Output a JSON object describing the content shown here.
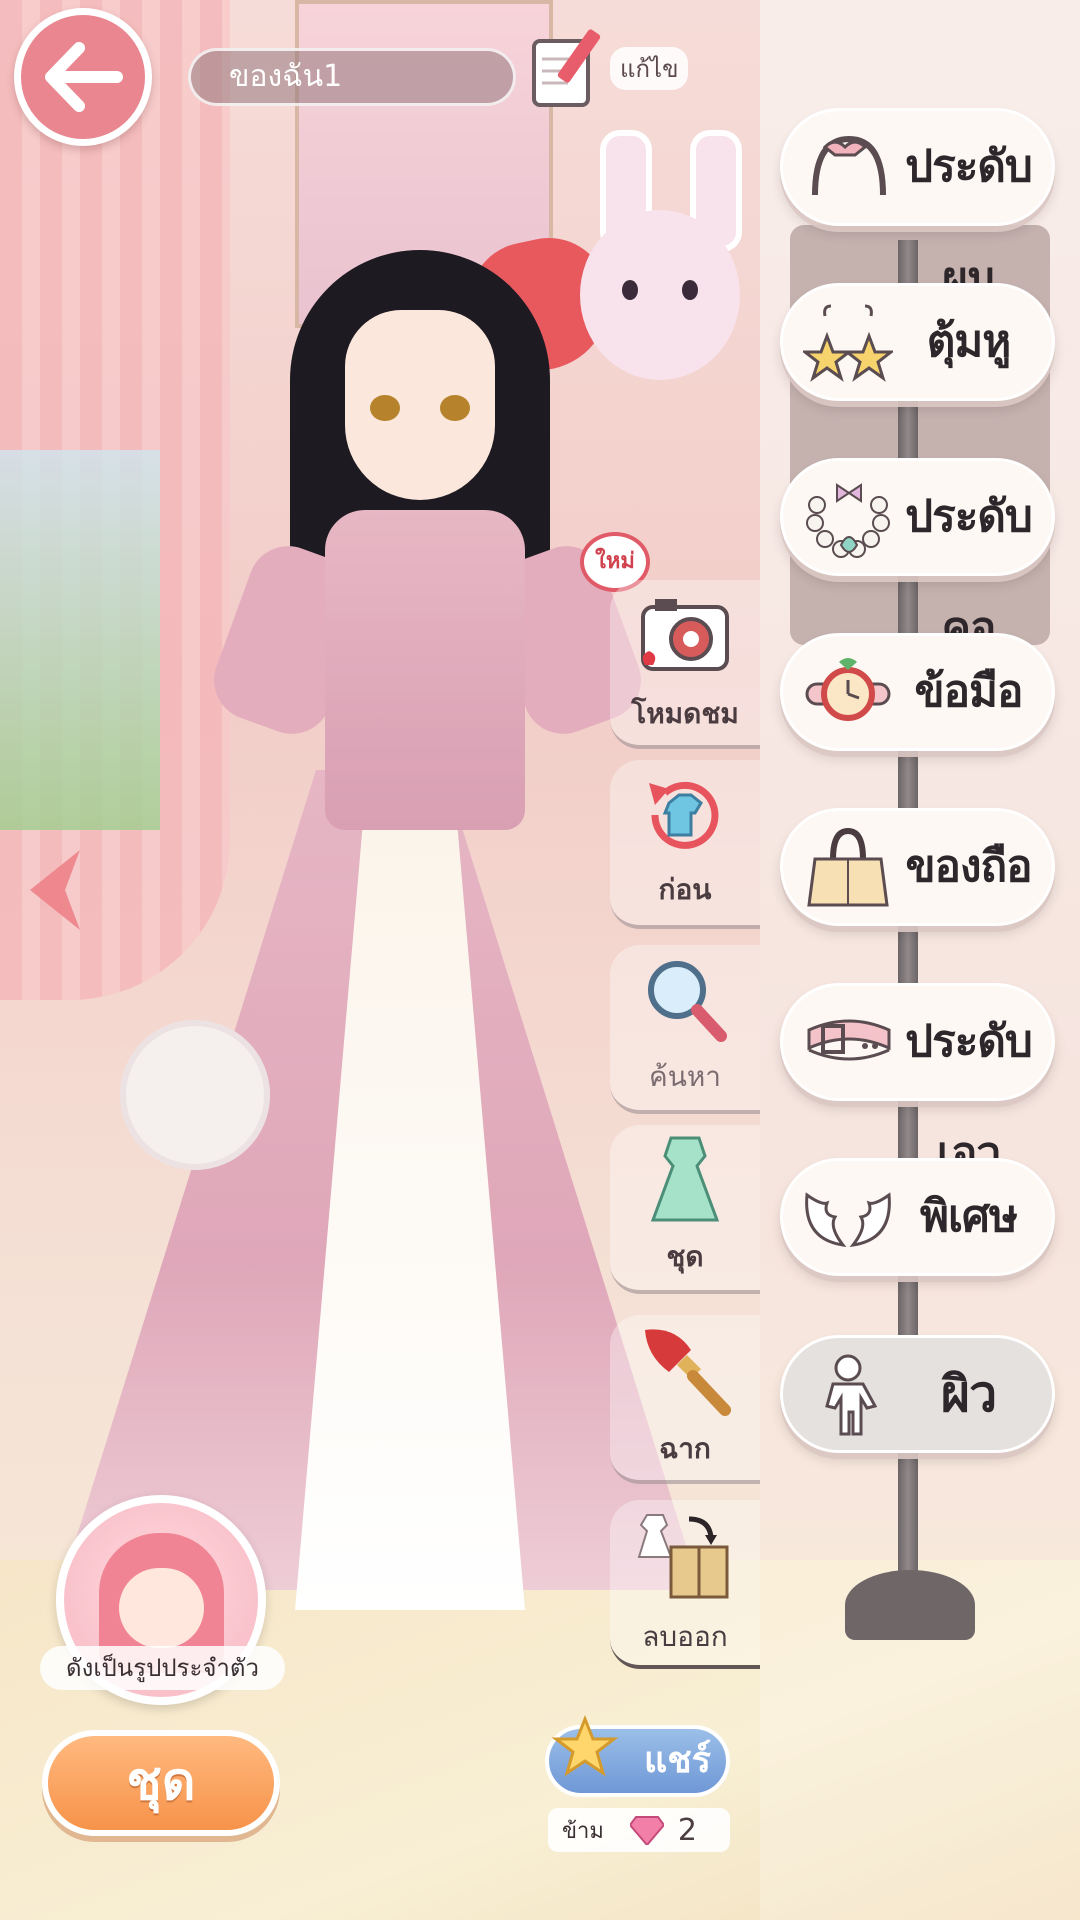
{
  "top_bar": {
    "outfit_name": "ของฉัน1",
    "edit_label": "แก้ไข"
  },
  "badges": {
    "new": "ใหม่"
  },
  "side_actions": [
    {
      "label": "โหมดชม",
      "icon": "camera-icon"
    },
    {
      "label": "ก่อน",
      "icon": "undo-outfit-icon"
    },
    {
      "label": "ค้นหา",
      "icon": "search-icon"
    },
    {
      "label": "ชุด",
      "icon": "dress-icon"
    },
    {
      "label": "ฉาก",
      "icon": "paintbrush-icon"
    },
    {
      "label": "ลบออก",
      "icon": "remove-to-box-icon"
    }
  ],
  "categories": [
    {
      "label": "ประดับผม",
      "icon": "headband-icon"
    },
    {
      "label": "ตุ้มหู",
      "icon": "star-earrings-icon"
    },
    {
      "label": "ประดับคอ",
      "icon": "necklace-icon"
    },
    {
      "label": "ข้อมือ",
      "icon": "wrist-watch-icon"
    },
    {
      "label": "ของถือ",
      "icon": "handbag-icon"
    },
    {
      "label": "ประดับเอว",
      "icon": "belt-icon"
    },
    {
      "label": "พิเศษ",
      "icon": "wings-icon"
    },
    {
      "label": "ผิว",
      "icon": "body-mannequin-icon"
    }
  ],
  "bottom": {
    "avatar_label": "ดังเป็นรูปประจำตัว",
    "outfit_button": "ชุด",
    "share_button": "แชร์",
    "skip_label": "ข้าม",
    "gem_count": "2"
  },
  "colors": {
    "back_button": "#e9868f",
    "outfit_button": "#f7934a",
    "share_button": "#6f98d6",
    "new_badge": "#e15a68"
  }
}
